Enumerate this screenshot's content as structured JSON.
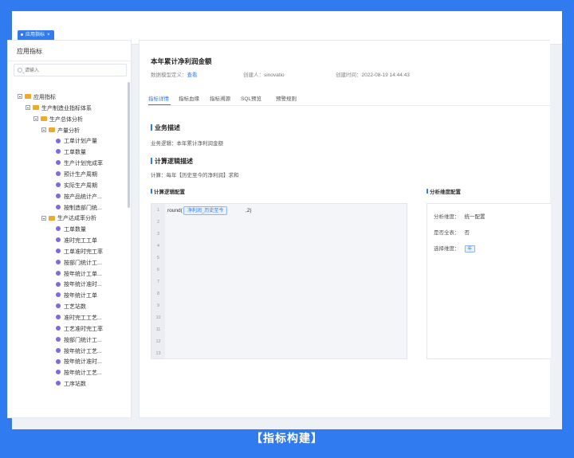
{
  "topbar": {
    "tab_label": "应用指标"
  },
  "sidebar": {
    "title": "应用指标",
    "search_placeholder": "请输入",
    "tree": [
      {
        "label": "应用指标",
        "type": "folder",
        "level": 0
      },
      {
        "label": "生产制造业指标体系",
        "type": "folder",
        "level": 1
      },
      {
        "label": "生产总体分析",
        "type": "folder",
        "level": 2
      },
      {
        "label": "产量分析",
        "type": "folder",
        "level": 3
      },
      {
        "label": "工单计划产量",
        "type": "leaf",
        "level": 4
      },
      {
        "label": "工单数量",
        "type": "leaf",
        "level": 4
      },
      {
        "label": "生产计划完成率",
        "type": "leaf",
        "level": 4
      },
      {
        "label": "预计生产周期",
        "type": "leaf",
        "level": 4
      },
      {
        "label": "实际生产周期",
        "type": "leaf",
        "level": 4
      },
      {
        "label": "按产品统计产...",
        "type": "leaf",
        "level": 4
      },
      {
        "label": "按制造部门统...",
        "type": "leaf",
        "level": 4
      },
      {
        "label": "生产达成率分析",
        "type": "folder",
        "level": 3
      },
      {
        "label": "工单数量",
        "type": "leaf",
        "level": 4
      },
      {
        "label": "准时完工工单",
        "type": "leaf",
        "level": 4
      },
      {
        "label": "工单准时完工率",
        "type": "leaf",
        "level": 4
      },
      {
        "label": "按部门统计工...",
        "type": "leaf",
        "level": 4
      },
      {
        "label": "按年统计工单...",
        "type": "leaf",
        "level": 4
      },
      {
        "label": "按年统计准时...",
        "type": "leaf",
        "level": 4
      },
      {
        "label": "按年统计工单",
        "type": "leaf",
        "level": 4
      },
      {
        "label": "工艺站数",
        "type": "leaf",
        "level": 4
      },
      {
        "label": "准时完工工艺...",
        "type": "leaf",
        "level": 4
      },
      {
        "label": "工艺准时完工率",
        "type": "leaf",
        "level": 4
      },
      {
        "label": "按部门统计工...",
        "type": "leaf",
        "level": 4
      },
      {
        "label": "按年统计工艺...",
        "type": "leaf",
        "level": 4
      },
      {
        "label": "按年统计准时...",
        "type": "leaf",
        "level": 4
      },
      {
        "label": "按年统计工艺...",
        "type": "leaf",
        "level": 4
      },
      {
        "label": "工序站数",
        "type": "leaf",
        "level": 4
      }
    ]
  },
  "detail": {
    "title": "本年累计净利润金额",
    "model_label": "数据模型定义：",
    "model_value": "查看",
    "creator_label": "创建人：",
    "creator_value": "sinovatio",
    "created_label": "创建时间：",
    "created_value": "2022-08-19 14:44:43",
    "tabs": [
      "指标详情",
      "指标血缘",
      "指标溯源",
      "SQL预览",
      "预警规则"
    ],
    "business_heading": "业务描述",
    "business_text": "业务逻辑：本年累计净利润金额",
    "calc_heading": "计算逻辑描述",
    "calc_text": "计算：每年【历史至今的净利润】求和",
    "logic_config_heading": "计算逻辑配置",
    "code_fn": "round(",
    "code_chip": "净利润_历史至今",
    "code_tail": ",2)",
    "line_numbers": [
      "1",
      "2",
      "3",
      "4",
      "5",
      "6",
      "7",
      "8",
      "9",
      "10",
      "11",
      "12",
      "13"
    ],
    "analysis_heading": "分析维度配置",
    "dim_label": "分析维度：",
    "dim_value": "统一配置",
    "all_label": "是否全表：",
    "all_value": "否",
    "select_label": "选择维度：",
    "select_value": "年"
  },
  "caption": "【指标构建】"
}
